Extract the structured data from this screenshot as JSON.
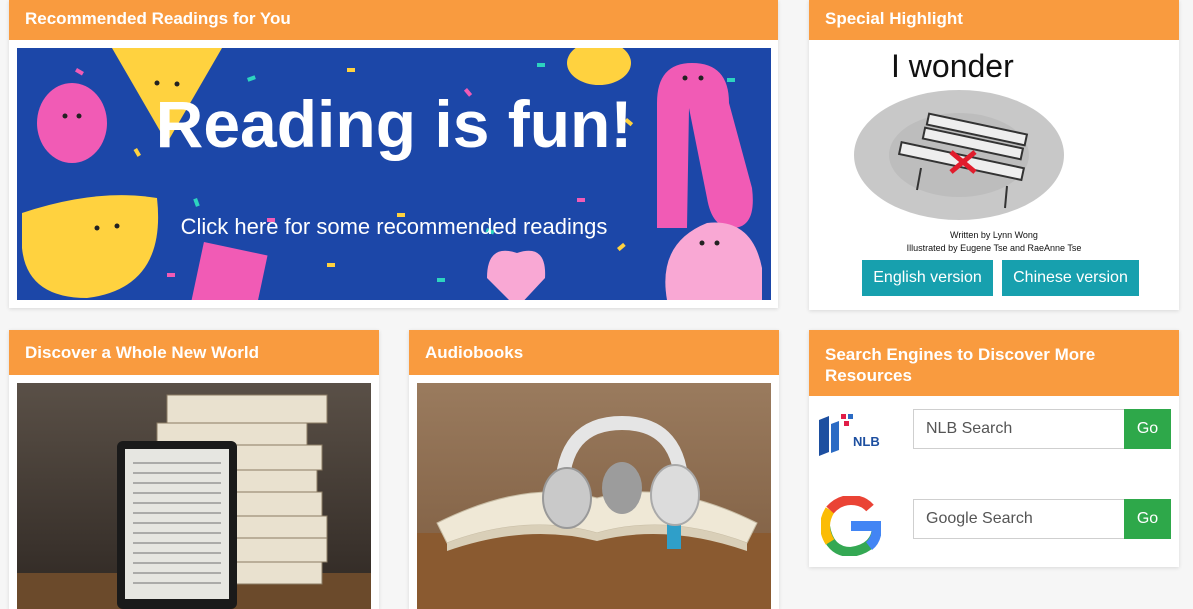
{
  "recommended": {
    "title": "Recommended Readings for You",
    "banner_headline": "Reading is fun!",
    "banner_subtext": "Click here for some recommended readings"
  },
  "highlight": {
    "title": "Special Highlight",
    "book_title": "I wonder",
    "written_by": "Written by Lynn Wong",
    "illustrated_by": "Illustrated by Eugene Tse and RaeAnne Tse",
    "english_label": "English version",
    "chinese_label": "Chinese version"
  },
  "discover": {
    "title": "Discover a Whole New World"
  },
  "audiobooks": {
    "title": "Audiobooks"
  },
  "search": {
    "title": "Search Engines to Discover More Resources",
    "nlb_logo_text": "NLB",
    "nlb_placeholder": "NLB Search",
    "google_placeholder": "Google Search",
    "go_label": "Go"
  },
  "colors": {
    "header": "#f99b3f",
    "teal_button": "#17a0ae",
    "go_button": "#2ea84a",
    "banner_bg": "#1c47a8"
  }
}
